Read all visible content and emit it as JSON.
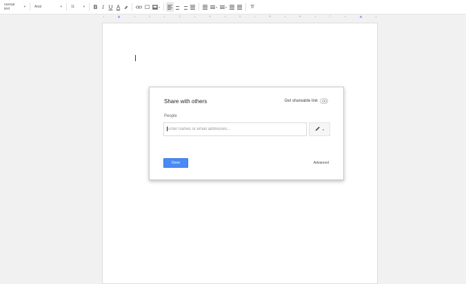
{
  "toolbar": {
    "style_select": "normal text",
    "font_select": "Arial",
    "size_select": "11",
    "bold": "B",
    "italic": "I",
    "underline": "U",
    "text_color": "A",
    "icons": [
      "highlight-icon",
      "link-icon",
      "comment-icon",
      "image-icon",
      "align-left-icon",
      "align-center-icon",
      "align-right-icon",
      "align-justify-icon",
      "line-spacing-icon",
      "numbered-list-icon",
      "bulleted-list-icon",
      "decrease-indent-icon",
      "increase-indent-icon",
      "clear-formatting-icon"
    ]
  },
  "ruler": {
    "numbers": [
      "1",
      "2",
      "3",
      "4",
      "5",
      "6",
      "7"
    ]
  },
  "dialog": {
    "title": "Share with others",
    "shareable_link": "Get shareable link",
    "people_label": "People",
    "email_placeholder": "Enter names or email addresses...",
    "done_label": "Done",
    "advanced_label": "Advanced"
  },
  "colors": {
    "accent": "#4a8af4",
    "background": "#f1f1f1"
  }
}
